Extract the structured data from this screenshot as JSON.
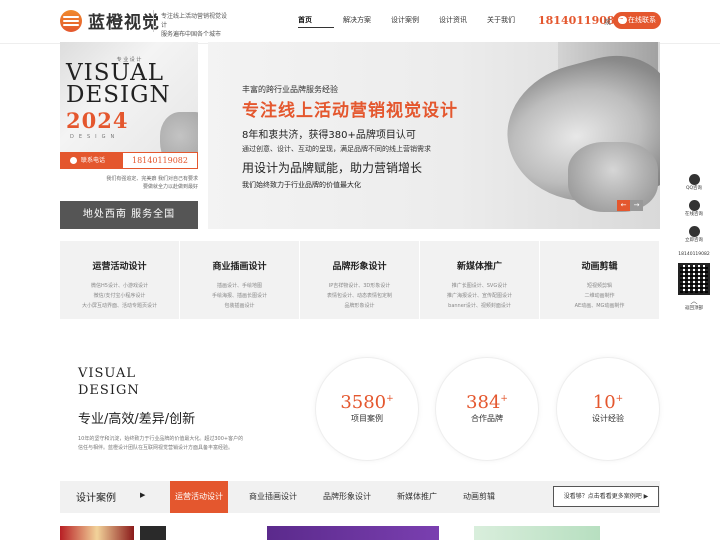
{
  "header": {
    "logo_text": "蓝橙视觉",
    "slogan_line1": "专注线上活动营销视觉设计",
    "slogan_line2": "服务遍布中国各个城市",
    "nav": [
      {
        "label": "首页",
        "active": true
      },
      {
        "label": "解决方案",
        "active": false
      },
      {
        "label": "设计案例",
        "active": false
      },
      {
        "label": "设计资讯",
        "active": false
      },
      {
        "label": "关于我们",
        "active": false
      }
    ],
    "phone": "18140119082",
    "or": "或",
    "online_button": "在线联系"
  },
  "left": {
    "top_note": "专 业 设 计",
    "visual": "VISUAL",
    "design": "DESIGN",
    "year": "2024",
    "design_small": "DESIGN",
    "contact_label": "联系电话",
    "contact_phone": "18140119082",
    "note": "我们有强追定、完美癖 我们对自己有要求 要做就全力以赴做到最好",
    "region": "地处西南 服务全国"
  },
  "banner": {
    "eyebrow": "丰富的跨行业品牌服务经验",
    "title": "专注线上活动营销视觉设计",
    "sub": "8年和衷共济，获得380+品牌项目认可",
    "line": "通过创意、设计、互动的呈现，满足品牌不同的线上营销需求",
    "big": "用设计为品牌赋能，助力营销增长",
    "small": "我们始终致力于行业品牌的价值最大化",
    "prev": "←",
    "next": "→"
  },
  "services": [
    {
      "title": "运营活动设计",
      "lines": [
        "微信H5设计、小游戏设计",
        "微信/支付宝小程序设计",
        "大小屏互动界面、活动专题页设计"
      ]
    },
    {
      "title": "商业插画设计",
      "lines": [
        "插画设计、手绘地图",
        "手绘海报、插画长图设计",
        "包装插画设计"
      ]
    },
    {
      "title": "品牌形象设计",
      "lines": [
        "IP吉祥物设计、3D形象设计",
        "表情包设计、动态表情包定制",
        "品牌形象设计"
      ]
    },
    {
      "title": "新媒体推广",
      "lines": [
        "推广长图设计、SVG设计",
        "推广海报设计、宣传配图设计",
        "banner设计、视频封面设计"
      ]
    },
    {
      "title": "动画剪辑",
      "lines": [
        "短视频剪辑",
        "二维动画制作",
        "AE动画、MG动画制作"
      ]
    }
  ],
  "about": {
    "visual": "VISUAL",
    "design": "DESIGN",
    "slogan": "专业/高效/差异/创新",
    "text": "10年的坚守和沉淀，始终致力于行业品牌的价值最大化。超过300+客户的信任与相伴。蓝橙设计团队在互联网视觉营销设计方面具备丰富经验。"
  },
  "stats": [
    {
      "num": "3580",
      "plus": "+",
      "label": "项目案例"
    },
    {
      "num": "384",
      "plus": "+",
      "label": "合作品牌"
    },
    {
      "num": "10",
      "plus": "+",
      "label": "设计经验"
    }
  ],
  "cases": {
    "title": "设计案例",
    "arrow": "▶",
    "tabs": [
      {
        "label": "运营活动设计",
        "active": true
      },
      {
        "label": "商业插画设计",
        "active": false
      },
      {
        "label": "品牌形象设计",
        "active": false
      },
      {
        "label": "新媒体推广",
        "active": false
      },
      {
        "label": "动画剪辑",
        "active": false
      }
    ],
    "more": "没看够？点击看看更多案例吧 ▶"
  },
  "sidebar": {
    "items": [
      {
        "label": "QQ咨询",
        "icon": "qq-icon"
      },
      {
        "label": "在线咨询",
        "icon": "chat-icon"
      },
      {
        "label": "立即咨询",
        "icon": "phone-icon"
      }
    ],
    "phone": "18140119082",
    "to_top": "返回顶部"
  },
  "colors": {
    "accent": "#e4572e",
    "bg_light": "#f2f2f2",
    "dark_box": "#555555"
  }
}
